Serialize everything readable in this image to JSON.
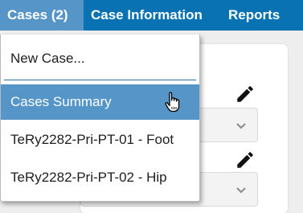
{
  "nav": {
    "cases_label": "Cases (2)",
    "case_information_label": "Case Information",
    "reports_label": "Reports"
  },
  "dropdown": {
    "new_case_label": "New Case...",
    "cases_summary_label": "Cases Summary",
    "cases": [
      {
        "label": "TeRy2282-Pri-PT-01 - Foot"
      },
      {
        "label": "TeRy2282-Pri-PT-02 - Hip"
      }
    ]
  },
  "icons": {
    "edit": "pencil-icon",
    "select_arrow": "chevron-down-icon",
    "cursor": "hand-pointer-icon"
  },
  "colors": {
    "topbar": "#0872b3",
    "highlight": "#5595c8",
    "text": "#1e1e1e"
  }
}
